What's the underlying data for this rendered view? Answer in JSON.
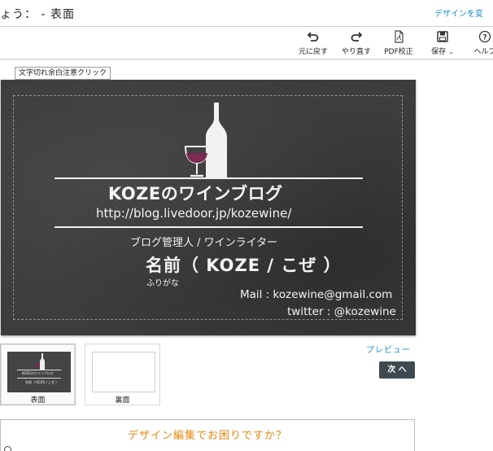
{
  "header": {
    "title": "ょう： - 表面",
    "change_design": "デザインを変"
  },
  "toolbar": {
    "undo": "元に戻す",
    "redo": "やり直す",
    "pdf_proof": "PDF校正",
    "save": "保存",
    "help": "ヘルプ"
  },
  "editor": {
    "warning_tip": "文字切れ余白注意クリック"
  },
  "card": {
    "blog_name": "KOZEのワインブログ",
    "blog_url": "http://blog.livedoor.jp/kozewine/",
    "role": "ブログ管理人 / ワインライター",
    "name": "名前（ KOZE / こぜ ）",
    "furigana": "ふりがな",
    "mail": "Mail : kozewine@gmail.com",
    "twitter": "twitter : @kozewine"
  },
  "thumbnails": [
    {
      "label": "表面",
      "selected": true
    },
    {
      "label": "裏面",
      "selected": false
    }
  ],
  "actions": {
    "preview": "プレビュー",
    "next": "次 へ"
  },
  "help": {
    "text": "デザイン編集でお困りですか？"
  },
  "colors": {
    "accent_link": "#1a8fc9",
    "help_text": "#e8850c",
    "next_button": "#3e4a50",
    "card_background": "#3b3b3b",
    "wine": "#7b2a52"
  }
}
